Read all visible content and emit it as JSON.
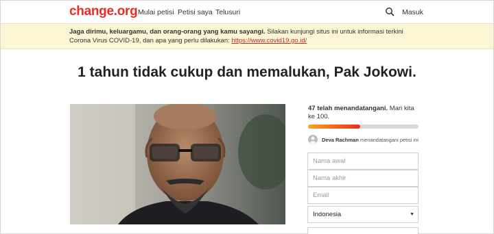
{
  "nav": {
    "logo": "change.org",
    "links": [
      "Mulai petisi",
      "Petisi saya",
      "Telusuri"
    ],
    "login": "Masuk"
  },
  "banner": {
    "bold": "Jaga dirimu, keluargamu, dan orang-orang yang kamu sayangi.",
    "text": " Silakan kunjungi situs ini untuk informasi terkini Corona Virus COVID-19, dan apa yang perlu dilakukan: ",
    "link": "https://www.covid19.go.id/"
  },
  "petition": {
    "title": "1 tahun tidak cukup dan memalukan, Pak Jokowi."
  },
  "signatures": {
    "count_label": "47 telah menandatangani.",
    "goal_label": " Mari kita ke 100.",
    "progress": 0.47,
    "recent_name": "Deva Rachman",
    "recent_action": " menandatangani petisi ini"
  },
  "form": {
    "first_name_placeholder": "Nama awal",
    "last_name_placeholder": "Nama akhir",
    "email_placeholder": "Email",
    "country": "Indonesia"
  },
  "colors": {
    "brand": "#ec2c22",
    "banner_bg": "#fdf6d4",
    "progress_start": "#f5a623",
    "progress_end": "#ec2c22"
  }
}
